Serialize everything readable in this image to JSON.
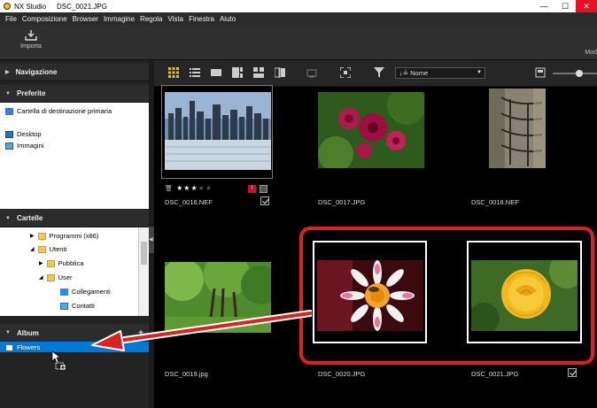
{
  "window": {
    "app_name": "NX Studio",
    "file_title": "DSC_0021.JPG",
    "minimize": "—",
    "maximize": "☐",
    "close": "✕"
  },
  "menu": [
    "File",
    "Composizione",
    "Browser",
    "Immagine",
    "Regola",
    "Vista",
    "Finestra",
    "Aiuto"
  ],
  "toolbar": {
    "import_label": "Importa",
    "right_label": "Mod"
  },
  "sidebar": {
    "navigation": "Navigazione",
    "favorites": {
      "title": "Preferite",
      "items": [
        "Cartella di destinazione primaria",
        "Desktop",
        "Immagini"
      ]
    },
    "folders": {
      "title": "Cartelle",
      "items": [
        "Programmi (x86)",
        "Utenti",
        "Pubblica",
        "User",
        "Collegamenti",
        "Contatti"
      ]
    },
    "album": {
      "title": "Album",
      "add": "+",
      "items": [
        "Flowers"
      ]
    }
  },
  "viewbar": {
    "sort_value": "Nome",
    "sort_prefix": "↓≟"
  },
  "thumbnails": [
    {
      "name": "DSC_0016.NEF",
      "rating": "★★★",
      "rating_empty": "★★",
      "badge": "!"
    },
    {
      "name": "DSC_0017.JPG"
    },
    {
      "name": "DSC_0018.NEF"
    },
    {
      "name": "DSC_0019.jpg"
    },
    {
      "name": "DSC_0020.JPG"
    },
    {
      "name": "DSC_0021.JPG"
    }
  ],
  "colors": {
    "accent_red": "#e0201f",
    "selection_blue": "#0078d7",
    "star_yellow": "#f7d200"
  }
}
